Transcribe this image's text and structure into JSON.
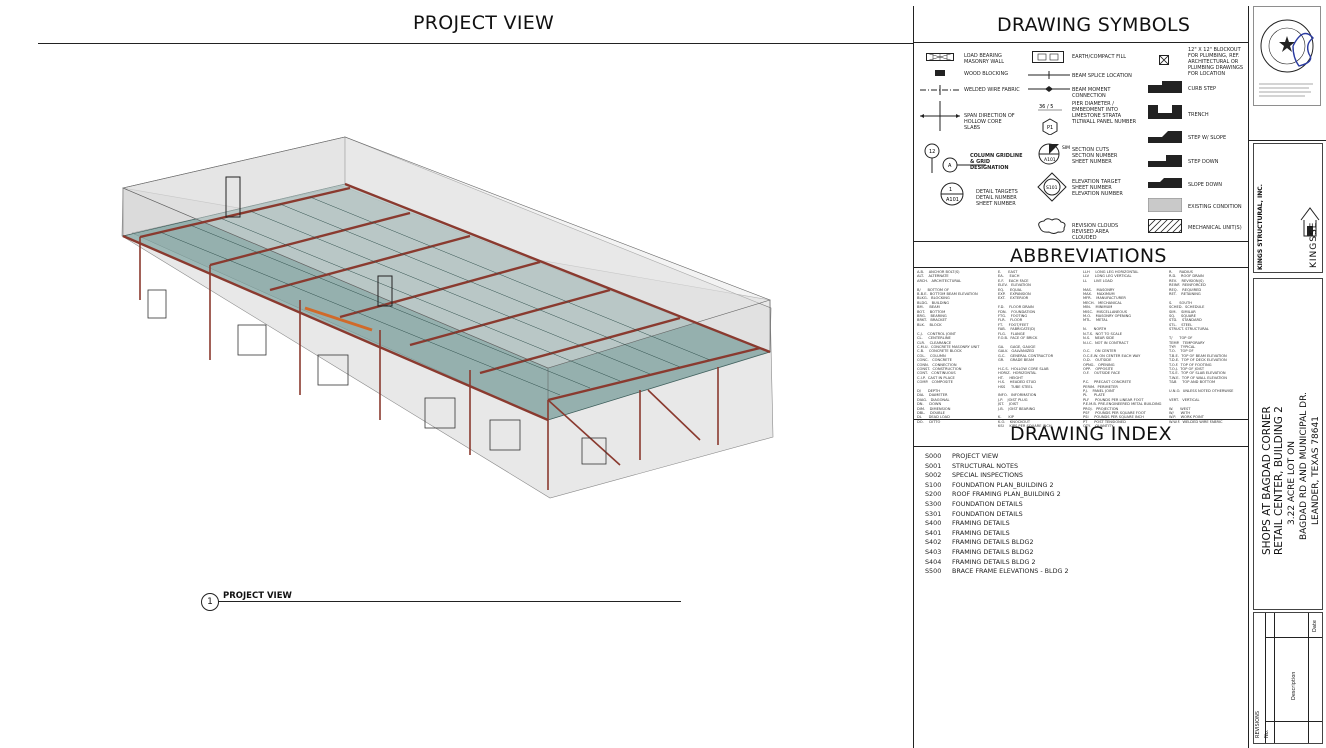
{
  "project_view": {
    "title": "PROJECT VIEW",
    "callout_number": "1",
    "callout_label": "PROJECT VIEW"
  },
  "symbols": {
    "title": "DRAWING SYMBOLS",
    "items": [
      "LOAD BEARING MASONRY WALL",
      "WOOD BLOCKING",
      "WELDED WIRE FABRIC",
      "SPAN DIRECTION OF HOLLOW CORE SLABS",
      "COLUMN GRIDLINE & GRID DESIGNATION",
      "DETAIL TARGETS DETAIL NUMBER SHEET NUMBER",
      "EARTH/COMPACT FILL",
      "BEAM SPLICE LOCATION",
      "BEAM MOMENT CONNECTION",
      "PIER DIAMETER / EMBEDMENT INTO LIMESTONE STRATA TILTWALL PANEL NUMBER",
      "SECTION CUTS SECTION NUMBER SHEET NUMBER",
      "ELEVATION TARGET SHEET NUMBER ELEVATION NUMBER",
      "REVISION CLOUDS REVISED AREA CLOUDED",
      "12\" X 12\" BLOCKOUT FOR PLUMBING, REF. ARCHITECTURAL OR PLUMBING DRAWINGS FOR LOCATION",
      "CURB STEP",
      "TRENCH",
      "STEP W/ SLOPE",
      "STEP DOWN",
      "SLOPE DOWN",
      "EXISTING CONDITION",
      "MECHANICAL UNIT(S)"
    ]
  },
  "abbreviations": {
    "title": "ABBREVIATIONS",
    "columns": [
      "A.B.    ANCHOR BOLT(S)\nALT.    ALTERNATE\nARCH.   ARCHITECTURAL\n\nB/      BOTTOM OF\nB.B.E.  BOTTOM BEAM ELEVATION\nBLKG.   BLOCKING\nBLDG.   BUILDING\nBM.     BEAM\nBOT.    BOTTOM\nBRG.    BEARING\nBRKT.   BRACKET\nBLK.    BLOCK\n\nC.J.    CONTROL JOINT\nCL.     CENTERLINE\nCLR.    CLEARANCE\nC.M.U.  CONCRETE MASONRY UNIT\nC.B.    CONCRETE BLOCK\nCOL.    COLUMN\nCONC.   CONCRETE\nCONN.   CONNECTION\nCONST.  CONSTRUCTION\nCONT.   CONTINUOUS\nC.I.P.  CAST IN PLACE\nCOMP.   COMPOSITE\n\nD/      DEPTH\nDIA.    DIAMETER\nDIAG.   DIAGONAL\nDN.     DOWN\nDIM.    DIMENSION\nDBL.    DOUBLE\nDL      DEAD LOAD\nDO.     DITTO",
      "E.      EAST\nEA.     EACH\nE.F.    EACH FACE\nELEV.   ELEVATION\nEQ.     EQUAL\nEXP.    EXPANSION\nEXT.    EXTERIOR\n\nF.D.    FLOOR DRAIN\nFDN.    FOUNDATION\nFTG.    FOOTING\nFLR.    FLOOR\nFT.     FOOT/FEET\nFAB.    FABRICATE(D)\nFLG.    FLANGE\nF.O.B.  FACE OF BRICK\n\nGA.     GAGE, GAUGE\nGALV.   GALVANIZED\nG.C.    GENERAL CONTRACTOR\nGR.     GRADE BEAM\n\nH.C.S.  HOLLOW CORE SLAB\nHORIZ.  HORIZONTAL\nHT.     HEIGHT\nH.S.    HEADED STUD\nHSS     TUBE STEEL\n\nINFO.   INFORMATION\nJ.P.    JOIST PLUG\nJST.    JOIST\nJ.B.    JOIST BEARING\n\nK.      KIP\nK.O.    KNOCKOUT\nKSI     KIPS PER SQUARE INCH",
      "LLH     LONG LEG HORIZONTAL\nLLV     LONG LEG VERTICAL\nLL      LIVE LOAD\n\nMAS.    MASONRY\nMAX.    MAXIMUM\nMFR.    MANUFACTURER\nMECH.   MECHANICAL\nMIN.    MINIMUM\nMISC.   MISCELLANEOUS\nM.O.    MASONRY OPENING\nMTL.    METAL\n\nN.      NORTH\nN.T.S.  NOT TO SCALE\nN.S.    NEAR SIDE\nN.I.C.  NOT IN CONTRACT\n\nO.C.    ON CENTER\nO.C.E.W. ON CENTER EACH WAY\nO.D.    OUTSIDE\nOPNG.   OPENING\nOPP.    OPPOSITE\nO.F.    OUTSIDE FACE\n\nP.C.    PRECAST CONCRETE\nPERIM.  PERIMETER\nP.J.    PANEL JOINT\nPL      PLATE\nPLF     POUNDS PER LINEAR FOOT\nP.E.M.B. PRE-ENGINEERED METAL BUILDING\nPROJ.   PROJECTION\nPSF     POUNDS PER SQUARE FOOT\nPSI     POUNDS PER SQUARE INCH\nPT      POST TENSIONED\nQTY.    QUANTITY",
      "R.      RADIUS\nR.D.    ROOF DRAIN\nREV.    REVISION(S)\nREINF.  REINFORCED\nREQ.    REQUIRED\nRET.    RETAINING\n\nS.      SOUTH\nSCHED.  SCHEDULE\nSIM.    SIMILAR\nSQ.     SQUARE\nSTD.    STANDARD\nSTL.    STEEL\nSTRUCT. STRUCTURAL\n\nT/      TOP OF\nTEMP.   TEMPORARY\nTYP.    TYPICAL\nT.O.    TOP OF\nT.B.E.  TOP OF BEAM ELEVATION\nT.D.E.  TOP OF DECK ELEVATION\nT.O.F.  TOP OF FOOTING\nT.O.J.  TOP OF JOIST\nT.S.E.  TOP OF SLAB ELEVATION\nT.W.E.  TOP OF WALL ELEVATION\nT&B     TOP AND BOTTOM\n\nU.N.O.  UNLESS NOTED OTHERWISE\n\nVERT.   VERTICAL\n\nW.      WEST\nW/      WITH\nW.P.    WORK POINT\nW.W.F.  WELDED WIRE FABRIC"
    ]
  },
  "drawing_index": {
    "title": "DRAWING INDEX",
    "rows": [
      {
        "num": "S000",
        "title": "PROJECT VIEW"
      },
      {
        "num": "S001",
        "title": "STRUCTURAL NOTES"
      },
      {
        "num": "S002",
        "title": "SPECIAL INSPECTIONS"
      },
      {
        "num": "S100",
        "title": "FOUNDATION PLAN_BUILDING 2"
      },
      {
        "num": "S200",
        "title": "ROOF FRAMING PLAN_BUILDING 2"
      },
      {
        "num": "S300",
        "title": "FOUNDATION DETAILS"
      },
      {
        "num": "S301",
        "title": "FOUNDATION DETAILS"
      },
      {
        "num": "S400",
        "title": "FRAMING DETAILS"
      },
      {
        "num": "S401",
        "title": "FRAMING DETAILS"
      },
      {
        "num": "S402",
        "title": "FRAMING DETAILS BLDG2"
      },
      {
        "num": "S403",
        "title": "FRAMING DETAILS BLDG2"
      },
      {
        "num": "S404",
        "title": "FRAMING DETAILS BLDG 2"
      },
      {
        "num": "S500",
        "title": "BRACE FRAME ELEVATIONS - BLDG 2"
      }
    ]
  },
  "title_block": {
    "firm_name": "KINGS STRUCTURAL, INC.",
    "firm_logo_text": "KINGSSE",
    "project_line1": "SHOPS AT BAGDAD CORNER",
    "project_line2": "RETAIL CENTER, BUILDING 2",
    "project_line3": "3.22 ACRE LOT ON",
    "project_line4": "BAGDAD RD AND MUNICIPAL DR.",
    "project_line5": "LEANDER, TEXAS 78641",
    "revisions_label": "REVISIONS",
    "rev_col_no": "No.",
    "rev_col_desc": "Description",
    "rev_col_date": "Date",
    "colors": {
      "steel_red": "#8a3a2f",
      "glass_teal": "#5e8f8c",
      "orange_beam": "#d06a2a"
    }
  }
}
